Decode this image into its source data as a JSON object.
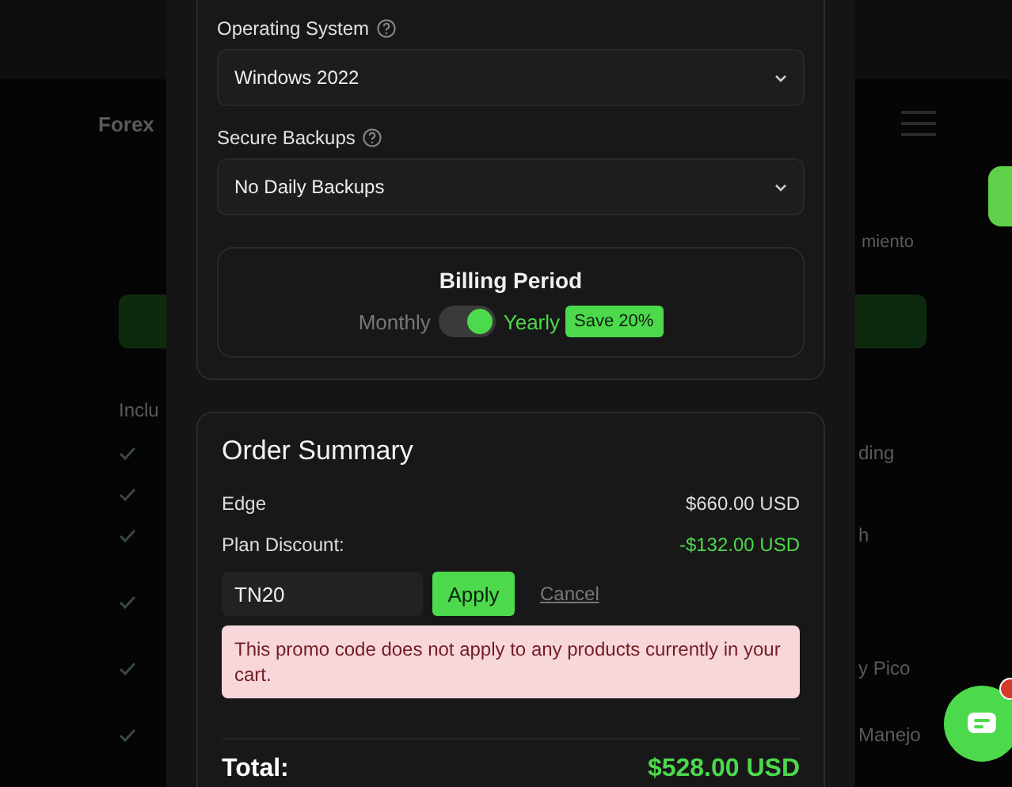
{
  "background_page": {
    "brand": "Forex",
    "intro_right": "miento",
    "includes_heading": "Inclu",
    "features": [
      {
        "checked": true,
        "right": "ding"
      },
      {
        "checked": true
      },
      {
        "checked": true,
        "right": "h"
      },
      {
        "checked": true
      },
      {
        "checked": true,
        "right": "y Pico"
      },
      {
        "checked": true,
        "right": "Manejo"
      }
    ]
  },
  "modal": {
    "fields": [
      {
        "label": "Operating System",
        "value": "Windows 2022"
      },
      {
        "label": "Secure Backups",
        "value": "No Daily Backups"
      }
    ],
    "billing": {
      "title": "Billing Period",
      "options": [
        {
          "label": "Monthly",
          "selected": false
        },
        {
          "label": "Yearly",
          "selected": true
        }
      ],
      "badge": "Save 20%"
    },
    "order_summary": {
      "title": "Order Summary",
      "lines": [
        {
          "label": "Edge",
          "amount": "$660.00 USD",
          "kind": "charge"
        },
        {
          "label": "Plan Discount:",
          "amount": "-$132.00 USD",
          "kind": "discount"
        }
      ],
      "promo": {
        "value": "TN20",
        "apply": "Apply",
        "cancel": "Cancel"
      },
      "error": "This promo code does not apply to any products currently in your cart.",
      "total": {
        "label": "Total:",
        "amount": "$528.00 USD"
      }
    }
  }
}
